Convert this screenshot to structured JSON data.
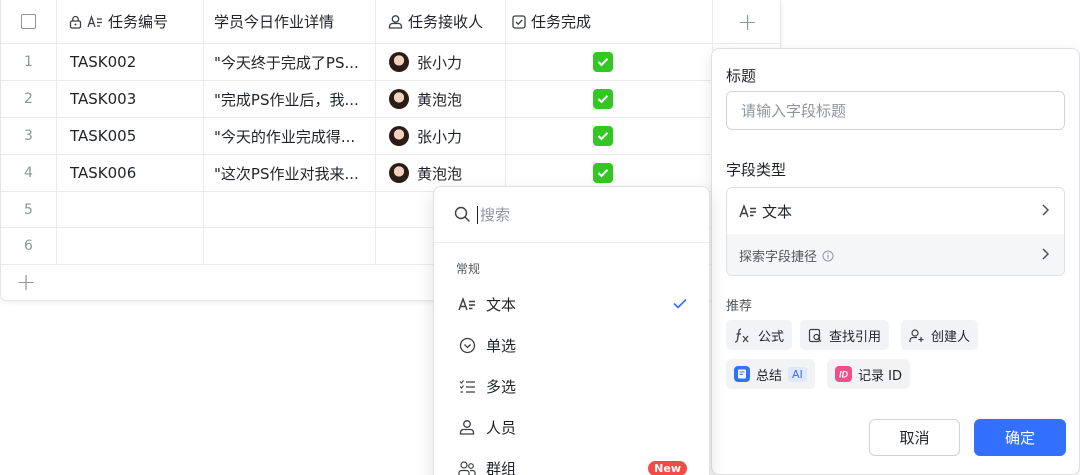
{
  "table": {
    "headers": {
      "task_id": "任务编号",
      "detail": "学员今日作业详情",
      "assignee": "任务接收人",
      "done": "任务完成"
    },
    "rows": [
      {
        "num": "1",
        "task_id": "TASK002",
        "detail": "\"今天终于完成了PS...",
        "assignee": "张小力",
        "done": true
      },
      {
        "num": "2",
        "task_id": "TASK003",
        "detail": "\"完成PS作业后，我...",
        "assignee": "黄泡泡",
        "done": true
      },
      {
        "num": "3",
        "task_id": "TASK005",
        "detail": "\"今天的作业完成得...",
        "assignee": "张小力",
        "done": true
      },
      {
        "num": "4",
        "task_id": "TASK006",
        "detail": "\"这次PS作业对我来...",
        "assignee": "黄泡泡",
        "done": true
      },
      {
        "num": "5"
      },
      {
        "num": "6"
      }
    ]
  },
  "panel": {
    "title_label": "标题",
    "title_placeholder": "请输入字段标题",
    "type_label": "字段类型",
    "type_value": "文本",
    "explore_label": "探索字段捷径",
    "recommend_label": "推荐",
    "chips": {
      "formula": "公式",
      "lookup": "查找引用",
      "creator": "创建人",
      "summary": "总结",
      "summary_badge": "AI",
      "record_id": "记录 ID"
    },
    "cancel": "取消",
    "confirm": "确定"
  },
  "dropdown": {
    "search_placeholder": "搜索",
    "group": "常规",
    "options": {
      "text": "文本",
      "single": "单选",
      "multi": "多选",
      "person": "人员",
      "group": "群组"
    },
    "new_badge": "New"
  },
  "colors": {
    "accent": "#3370ff",
    "done_green": "#34c724",
    "new_red": "#f54a45"
  }
}
